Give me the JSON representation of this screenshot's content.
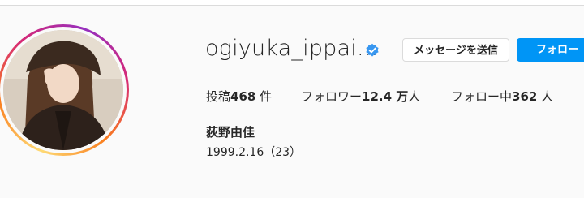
{
  "profile": {
    "username": "ogiyuka_ippai...",
    "full_name": "荻野由佳",
    "bio": "1999.2.16（23）",
    "verified_icon": "verified-badge-icon",
    "accent_color": "#0095f6"
  },
  "actions": {
    "message_label": "メッセージを送信",
    "follow_label": "フォロー"
  },
  "stats": {
    "posts_prefix": "投稿",
    "posts_count": "468",
    "posts_suffix": " 件",
    "followers_prefix": "フォロワー",
    "followers_count": "12.4 万",
    "followers_suffix": "人",
    "following_prefix": "フォロー中",
    "following_count": "362",
    "following_suffix": " 人"
  }
}
